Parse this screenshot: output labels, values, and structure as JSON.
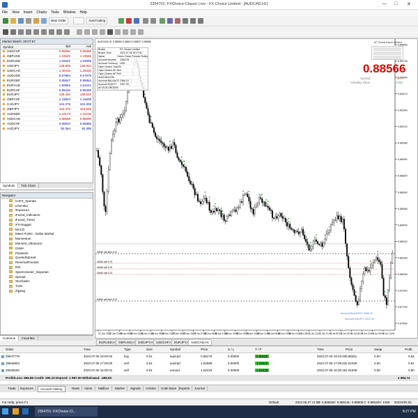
{
  "window": {
    "title": "2354701: FXChoice-Classic Live - FX Choice Limited - [AUDCAD,H1]",
    "min": "—",
    "max": "□",
    "close": "✕"
  },
  "menu": [
    "File",
    "View",
    "Insert",
    "Charts",
    "Tools",
    "Window",
    "Help"
  ],
  "toolbar": {
    "new_order": "New Order",
    "autotrading": "AutoTrading"
  },
  "market_watch": {
    "title": "Market Watch: 20:07:57",
    "cols": [
      "Symbol",
      "Bid",
      "Ask"
    ],
    "rows": [
      {
        "s": "USDCHF",
        "b": "0.96860",
        "a": "0.96889",
        "c": "red"
      },
      {
        "s": "GBPUSD",
        "b": "1.19540",
        "a": "1.19566",
        "c": "red"
      },
      {
        "s": "EURUSD",
        "b": "1.02642",
        "a": "1.02659",
        "c": "blu"
      },
      {
        "s": "USDJPY",
        "b": "135.905",
        "a": "135.924",
        "c": "red"
      },
      {
        "s": "USDCAD",
        "b": "1.30316",
        "a": "1.30330",
        "c": "red"
      },
      {
        "s": "AUDUSD",
        "b": "0.67964",
        "a": "0.67979",
        "c": "blu"
      },
      {
        "s": "EURGBP",
        "b": "0.85847",
        "a": "0.85864",
        "c": "blu"
      },
      {
        "s": "EURAUD",
        "b": "1.50993",
        "a": "1.51041",
        "c": "blu"
      },
      {
        "s": "EURCHF",
        "b": "0.99426",
        "a": "0.99458",
        "c": "blu"
      },
      {
        "s": "EURJPY",
        "b": "139.493",
        "a": "139.523",
        "c": "red"
      },
      {
        "s": "GBPCHF",
        "b": "1.15804",
        "a": "1.15839",
        "c": "blu"
      },
      {
        "s": "CADJPY",
        "b": "104.276",
        "a": "104.305",
        "c": "blu"
      },
      {
        "s": "GBPJPY",
        "b": "162.475",
        "a": "162.505",
        "c": "red"
      },
      {
        "s": "AUDNZD",
        "b": "1.10173",
        "a": "1.10215",
        "c": "red"
      },
      {
        "s": "AUDCAD",
        "b": "0.88566",
        "a": "0.88596",
        "c": "red"
      },
      {
        "s": "AUDCHF",
        "b": "0.65834",
        "a": "0.65866",
        "c": "blu"
      },
      {
        "s": "AUDJPY",
        "b": "92.364",
        "a": "92.395",
        "c": "blu"
      }
    ],
    "tabs": [
      "Symbols",
      "Tick Chart"
    ]
  },
  "navigator": {
    "title": "Navigator",
    "items": [
      "IcoFX_Sperate",
      "Ichimoku",
      "iExposure",
      "iFuzed_Indicators",
      "iFuzed_Trend",
      "iFX-Nugget",
      "MACD",
      "Maes Points - Dollar Market",
      "Momentum",
      "Moment_Ultrasonic",
      "OsMA",
      "Parabolic",
      "QuotedSpread",
      "ReversalFractals",
      "RSI",
      "Spectrometer_Separate",
      "Spread",
      "Stochastic",
      "Ticks",
      "ZigZag"
    ],
    "tabs": [
      "Common",
      "Favorites"
    ]
  },
  "chart": {
    "symbol_line": "AUDCAD,H1  0.88566 0.88613 0.88537 0.88566",
    "expert_title": "AP Global Expert Limited",
    "big_price": "0.88566",
    "spread_label": "Spread",
    "spread_value": "30.0",
    "volat_label": "Volatility Ratio",
    "volat_value": "0.93",
    "panel_rows": [
      {
        "k": "Broker",
        "v": "FX Choice Limited"
      },
      {
        "k": "Broker Time",
        "v": "2022.07.06 20:07:52"
      },
      {
        "k": "Name",
        "v": "Green Onion Premier Rollingcat"
      },
      {
        "k": "Account Number",
        "v": "2354701"
      },
      {
        "k": "Account Currency",
        "v": "USD"
      },
      {
        "k": "Open Orders Total Buyline",
        "v": "0"
      },
      {
        "k": "Open Orders AP-Sentiment",
        "v": "0"
      },
      {
        "k": "Open Orders AP-PendingMode",
        "v": "0"
      },
      {
        "k": "AUDCADCOM",
        "v": ""
      },
      {
        "k": "Account BALANCE",
        "v": "2366.16"
      },
      {
        "k": "Account EQUITY",
        "v": "2337.99"
      },
      {
        "k": "AP-ECB ORDERS",
        "v": ""
      }
    ],
    "account_notes": [
      "Account BALANCE: 2366.16",
      "Account EQUITY: 2337.99"
    ],
    "y_ticks": [
      "0.89850",
      "0.89725",
      "0.89600",
      "0.89470",
      "0.89340",
      "0.89210",
      "0.89080",
      "0.88950",
      "0.88820",
      "0.88690",
      "0.88566",
      "0.88440",
      "0.88310",
      "0.88180",
      "0.88050",
      "0.87920",
      "0.87790",
      "0.87660"
    ],
    "x_ticks": [
      "22 Jun 2022",
      "22 Jun 21:00",
      "23 Jun 05:00",
      "23 Jun 13:00",
      "23 Jun 21:00",
      "24 Jun 05:00",
      "24 Jun 13:00",
      "27 Jun 05:00",
      "27 Jun 13:00",
      "27 Jun 21:00",
      "28 Jun 05:00",
      "28 Jun 13:00",
      "28 Jun 21:00",
      "29 Jun 05:00",
      "29 Jun 13:00",
      "29 Jun 21:00",
      "30 Jun 05:00",
      "30 Jun 13:00",
      "30 Jun 21:00",
      "1 Jul 05:00",
      "1 Jul 13:00",
      "1 Jul 21:00",
      "4 Jul 05:00",
      "4 Jul 13:00",
      "5 Jul 05:00",
      "5 Jul 13:00",
      "6 Jul 05:00",
      "6 Jul 13:00"
    ],
    "level_labels": [
      "#2640 sell limit 0.01",
      "#2640 sell 0.01",
      "#2640 sell 0.01",
      "#2640 sell 0.01",
      "#2640 sell limit 0.01"
    ],
    "tabs": [
      "EURUSD,H1",
      "GBPUSD,H1",
      "USDJPY,H1",
      "USDCHF,H1",
      "EURJPY,H1",
      "AUDCAD,H1"
    ],
    "active_tab": 5
  },
  "terminal": {
    "cols": [
      "Order",
      "Time",
      "Type",
      "Size",
      "Symbol",
      "Price",
      "S / L",
      "T / P",
      "Time",
      "Price",
      "Swap",
      "Profit"
    ],
    "rows": [
      {
        "o": "26947776",
        "t": "2022.07.05 16:00:02",
        "ty": "buy",
        "sz": "0.01",
        "sym": "audcad",
        "p": "0.88170",
        "sl": "0.00000",
        "tp": "0.88250",
        "t2": "2022.07.05 19:43:20",
        "p2": "0.88251",
        "sw": "0.00",
        "pr": "0.64"
      },
      {
        "o": "26946904",
        "t": "2022.07.05 17:00:00",
        "ty": "sell",
        "sz": "0.01",
        "sym": "audcad",
        "p": "1.02599",
        "sl": "0.00000",
        "tp": "1.02519",
        "t2": "2022.07.05 17:08:33",
        "p2": "1.02338",
        "sw": "0.00",
        "pr": "0.61"
      },
      {
        "o": "26946160",
        "t": "2022.07.05 16:00:01",
        "ty": "sell",
        "sz": "0.01",
        "sym": "eurusd",
        "p": "1.02419",
        "sl": "0.00000",
        "tp": "1.02339",
        "t2": "2022.07.05 16:20:16",
        "p2": "1.02339",
        "sw": "0.00",
        "pr": "0.80"
      }
    ],
    "balance_line": "Profit/Loss: 555.85  Credit: 290.10  Deposit: 1 987.00  Withdrawal: -459.00",
    "balance_total": "2 084.74",
    "tabs": [
      "Trade",
      "Exposure",
      "Account History",
      "News",
      "Alerts",
      "Mailbox",
      "Market",
      "Signals",
      "Articles",
      "Code Base",
      "Experts",
      "Journal"
    ],
    "active_tab": 2
  },
  "status": {
    "help": "For Help, press F1",
    "profile": "Default",
    "time": "2022.06.27 11:00",
    "o": "O: 0.88584",
    "h": "H: 0.88613",
    "l": "L: 0.88506",
    "c": "C: 0.88526",
    "v": "V: 1466",
    "kb": "50323/26 kb"
  },
  "taskbar": {
    "app": "2354701: FXChoice-Cl...",
    "clock": "8:27 PM"
  }
}
